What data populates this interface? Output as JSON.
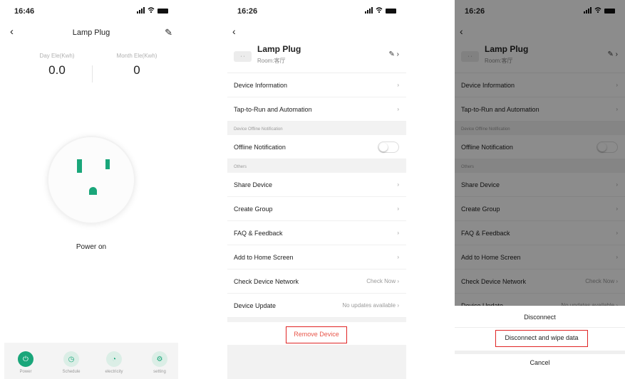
{
  "screen1": {
    "time": "16:46",
    "title": "Lamp Plug",
    "stats": [
      {
        "label": "Day Ele(Kwh)",
        "value": "0.0"
      },
      {
        "label": "Month Ele(Kwh)",
        "value": "0"
      }
    ],
    "power_label": "Power on",
    "tabs": [
      {
        "label": "Power",
        "icon": "⏻"
      },
      {
        "label": "Schedule",
        "icon": "◷"
      },
      {
        "label": "electricity",
        "icon": "◔"
      },
      {
        "label": "setting",
        "icon": "⚙"
      }
    ]
  },
  "screen2": {
    "time": "16:26",
    "device_name": "Lamp Plug",
    "room": "Room:客厅",
    "rows": {
      "device_information": "Device Information",
      "tap_to_run": "Tap-to-Run and Automation",
      "offline_section": "Device Offline Notification",
      "offline_notification": "Offline Notification",
      "others_section": "Others",
      "share_device": "Share Device",
      "create_group": "Create Group",
      "faq": "FAQ & Feedback",
      "add_home": "Add to Home Screen",
      "check_network": "Check Device Network",
      "check_network_value": "Check Now",
      "device_update": "Device Update",
      "device_update_value": "No updates available"
    },
    "remove_device": "Remove Device"
  },
  "screen3": {
    "time": "16:26",
    "sheet": {
      "disconnect": "Disconnect",
      "wipe": "Disconnect and wipe data",
      "cancel": "Cancel"
    }
  },
  "colors": {
    "accent": "#1aa67a",
    "danger": "#e8564a",
    "highlight_box": "#e02424"
  }
}
